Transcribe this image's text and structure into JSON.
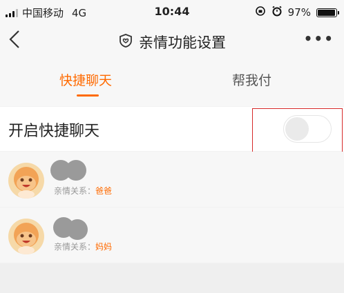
{
  "status_bar": {
    "carrier": "中国移动",
    "network": "4G",
    "time": "10:44",
    "battery": "97%",
    "battery_level": 0.97
  },
  "nav": {
    "title": "亲情功能设置",
    "more": "•••"
  },
  "tabs": [
    {
      "label": "快捷聊天",
      "active": true
    },
    {
      "label": "帮我付",
      "active": false
    }
  ],
  "quick_chat": {
    "label": "开启快捷聊天",
    "enabled": false
  },
  "contacts": [
    {
      "relation_label": "亲情关系：",
      "relation": "爸爸"
    },
    {
      "relation_label": "亲情关系：",
      "relation": "妈妈"
    }
  ],
  "colors": {
    "accent": "#ff6a00",
    "highlight_box": "#d62828"
  }
}
